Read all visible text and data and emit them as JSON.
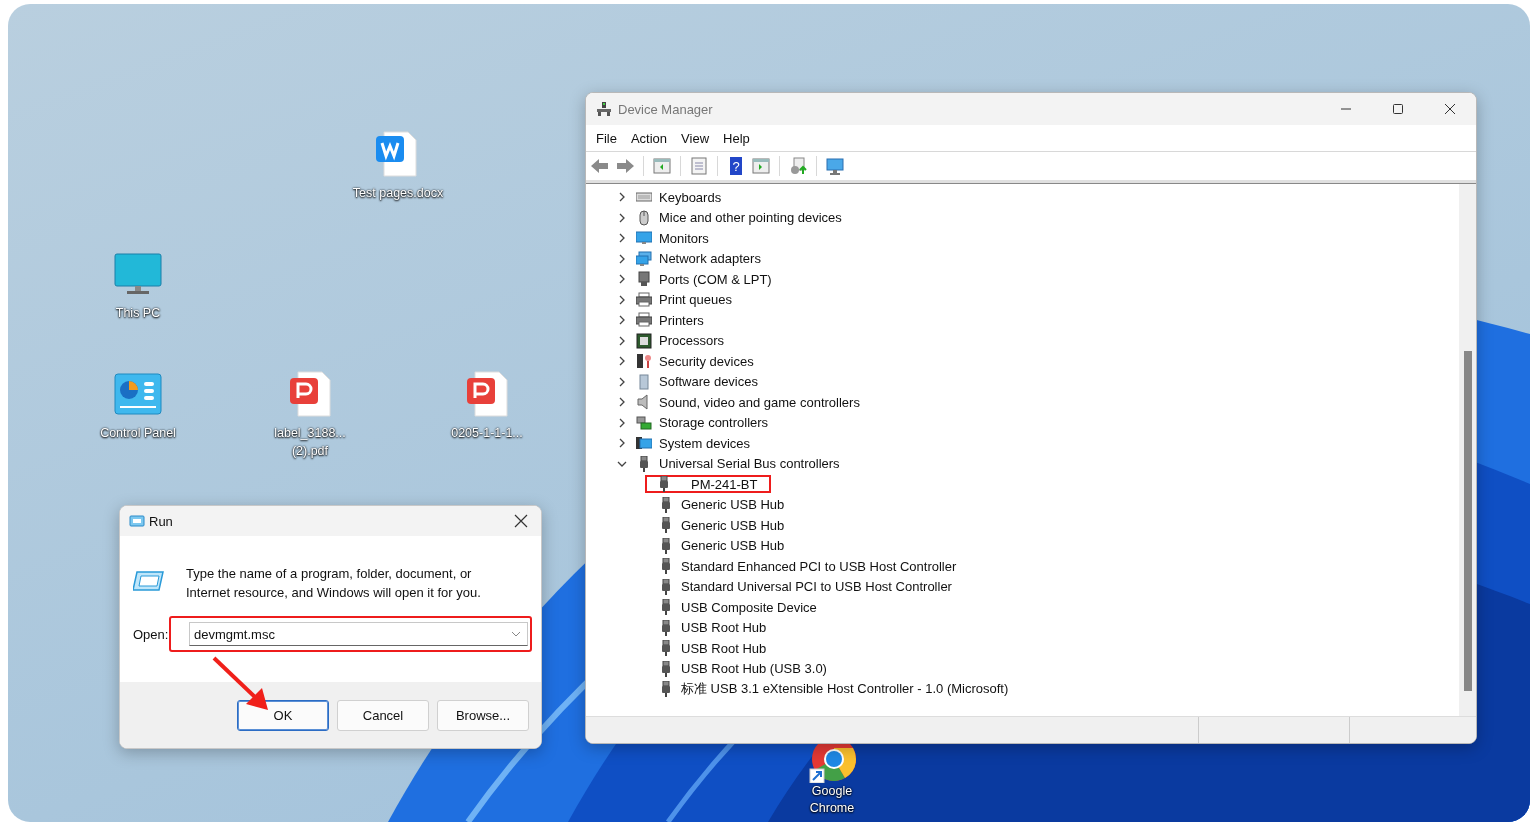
{
  "desktop": {
    "icons": [
      {
        "kind": "word",
        "label": "Test pages.docx",
        "shortcut": false
      },
      {
        "kind": "computer",
        "label": "This PC",
        "shortcut": false
      },
      {
        "kind": "control-panel",
        "label": "Control Panel",
        "shortcut": false
      },
      {
        "kind": "pdf",
        "label": "label_3188... (2).pdf",
        "shortcut": false
      },
      {
        "kind": "pdf",
        "label": "0205-1-1-1...",
        "shortcut": false
      },
      {
        "kind": "chrome",
        "label": "Google Chrome",
        "shortcut": true
      }
    ]
  },
  "device_manager": {
    "title": "Device Manager",
    "menu": [
      "File",
      "Action",
      "View",
      "Help"
    ],
    "toolbar": [
      {
        "kind": "back"
      },
      {
        "kind": "forward"
      },
      {
        "kind": "tree-pane"
      },
      {
        "kind": "properties"
      },
      {
        "kind": "help",
        "glyph": "?"
      },
      {
        "kind": "action-pane"
      },
      {
        "kind": "update-driver"
      },
      {
        "kind": "scan"
      }
    ],
    "tree": [
      {
        "kind": "keyboard",
        "label": "Keyboards",
        "expanded": false
      },
      {
        "kind": "mouse",
        "label": "Mice and other pointing devices",
        "expanded": false
      },
      {
        "kind": "monitor",
        "label": "Monitors",
        "expanded": false
      },
      {
        "kind": "network",
        "label": "Network adapters",
        "expanded": false
      },
      {
        "kind": "port",
        "label": "Ports (COM & LPT)",
        "expanded": false
      },
      {
        "kind": "printer",
        "label": "Print queues",
        "expanded": false
      },
      {
        "kind": "printer",
        "label": "Printers",
        "expanded": false
      },
      {
        "kind": "processor",
        "label": "Processors",
        "expanded": false
      },
      {
        "kind": "security",
        "label": "Security devices",
        "expanded": false
      },
      {
        "kind": "software",
        "label": "Software devices",
        "expanded": false
      },
      {
        "kind": "sound",
        "label": "Sound, video and game controllers",
        "expanded": false
      },
      {
        "kind": "storage",
        "label": "Storage controllers",
        "expanded": false
      },
      {
        "kind": "system",
        "label": "System devices",
        "expanded": false
      },
      {
        "kind": "usb",
        "label": "Universal Serial Bus controllers",
        "expanded": true,
        "children": [
          {
            "label": "PM-241-BT",
            "highlighted": true
          },
          {
            "label": "Generic USB Hub",
            "highlighted": false
          },
          {
            "label": "Generic USB Hub",
            "highlighted": false
          },
          {
            "label": "Generic USB Hub",
            "highlighted": false
          },
          {
            "label": "Standard Enhanced PCI to USB Host Controller",
            "highlighted": false
          },
          {
            "label": "Standard Universal PCI to USB Host Controller",
            "highlighted": false
          },
          {
            "label": "USB Composite Device",
            "highlighted": false
          },
          {
            "label": "USB Root Hub",
            "highlighted": false
          },
          {
            "label": "USB Root Hub",
            "highlighted": false
          },
          {
            "label": "USB Root Hub (USB 3.0)",
            "highlighted": false
          },
          {
            "label": "标准 USB 3.1 eXtensible Host Controller - 1.0 (Microsoft)",
            "highlighted": false
          }
        ]
      }
    ]
  },
  "run": {
    "title": "Run",
    "message": "Type the name of a program, folder, document, or Internet resource, and Windows will open it for you.",
    "open_label": "Open:",
    "value": "devmgmt.msc",
    "highlighted": true,
    "buttons": [
      {
        "label": "OK",
        "focused": true
      },
      {
        "label": "Cancel",
        "focused": false
      },
      {
        "label": "Browse...",
        "focused": false
      }
    ]
  }
}
